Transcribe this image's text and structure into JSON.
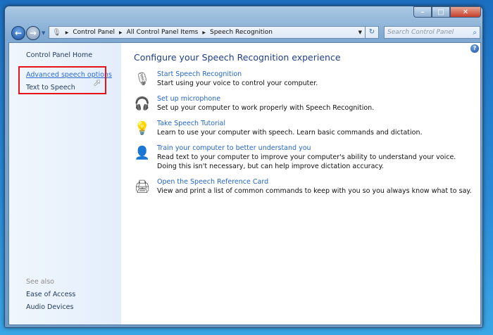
{
  "window": {
    "caption_buttons": [
      "minimize",
      "maximize",
      "close"
    ]
  },
  "nav": {
    "back": "back-arrow",
    "forward": "forward-arrow"
  },
  "address": {
    "crumbs": [
      "Control Panel",
      "All Control Panel Items",
      "Speech Recognition"
    ]
  },
  "search": {
    "placeholder": "Search Control Panel"
  },
  "sidebar": {
    "home": "Control Panel Home",
    "links": [
      "Advanced speech options",
      "Text to Speech"
    ],
    "see_also": "See also",
    "see_also_links": [
      "Ease of Access",
      "Audio Devices"
    ]
  },
  "main": {
    "title": "Configure your Speech Recognition experience",
    "tasks": [
      {
        "link": "Start Speech Recognition",
        "desc": "Start using your voice to control your computer.",
        "icon": "microphone-icon"
      },
      {
        "link": "Set up microphone",
        "desc": "Set up your computer to work properly with Speech Recognition.",
        "icon": "headset-icon"
      },
      {
        "link": "Take Speech Tutorial",
        "desc": "Learn to use your computer with speech.  Learn basic commands and dictation.",
        "icon": "lightbulb-icon"
      },
      {
        "link": "Train your computer to better understand you",
        "desc": "Read text to your computer to improve your computer's ability to understand your voice.  Doing this isn't necessary, but can help improve dictation accuracy.",
        "icon": "user-icon"
      },
      {
        "link": "Open the Speech Reference Card",
        "desc": "View and print a list of common commands to keep with you so you always know what to say.",
        "icon": "printer-icon"
      }
    ]
  },
  "colors": {
    "link": "#2465c8",
    "highlight": "#e8131a"
  }
}
